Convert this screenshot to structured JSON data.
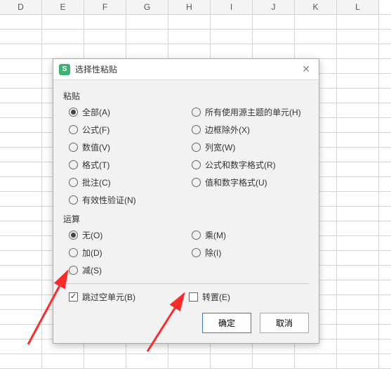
{
  "columns": [
    "D",
    "E",
    "F",
    "G",
    "H",
    "I",
    "J",
    "K",
    "L"
  ],
  "dialog": {
    "title": "选择性粘贴",
    "section_paste": "粘贴",
    "paste_options": {
      "left": [
        {
          "label": "全部(A)",
          "checked": true
        },
        {
          "label": "公式(F)",
          "checked": false
        },
        {
          "label": "数值(V)",
          "checked": false
        },
        {
          "label": "格式(T)",
          "checked": false
        },
        {
          "label": "批注(C)",
          "checked": false
        },
        {
          "label": "有效性验证(N)",
          "checked": false
        }
      ],
      "right": [
        {
          "label": "所有使用源主题的单元(H)",
          "checked": false
        },
        {
          "label": "边框除外(X)",
          "checked": false
        },
        {
          "label": "列宽(W)",
          "checked": false
        },
        {
          "label": "公式和数字格式(R)",
          "checked": false
        },
        {
          "label": "值和数字格式(U)",
          "checked": false
        }
      ]
    },
    "section_op": "运算",
    "op_options": {
      "left": [
        {
          "label": "无(O)",
          "checked": true
        },
        {
          "label": "加(D)",
          "checked": false
        },
        {
          "label": "减(S)",
          "checked": false
        }
      ],
      "right": [
        {
          "label": "乘(M)",
          "checked": false
        },
        {
          "label": "除(I)",
          "checked": false
        }
      ]
    },
    "skip_blanks": {
      "label": "跳过空单元(B)",
      "checked": true
    },
    "transpose": {
      "label": "转置(E)",
      "checked": false
    },
    "ok": "确定",
    "cancel": "取消"
  },
  "app_icon_letter": "S"
}
